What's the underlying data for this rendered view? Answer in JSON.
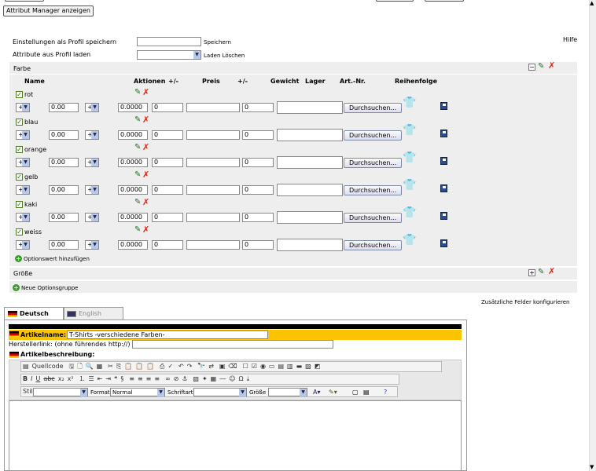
{
  "top": {
    "attr_manager_button": "Attribut Manager anzeigen",
    "help": "Hilfe"
  },
  "profile": {
    "save_label": "Einstellungen als Profil speichern",
    "save_link": "Speichern",
    "load_label": "Attribute aus Profil laden",
    "load_link": "Laden Löschen"
  },
  "group_farbe": {
    "title": "Farbe",
    "columns": {
      "name": "Name",
      "aktionen": "Aktionen",
      "pm1": "+/-",
      "preis": "Preis",
      "pm2": "+/-",
      "gewicht": "Gewicht",
      "lager": "Lager",
      "artnr": "Art.-Nr.",
      "reihenfolge": "Reihenfolge"
    },
    "rows": [
      {
        "name": "rot",
        "sign": "+",
        "price": "0.00",
        "sign2": "+",
        "weight": "0.0000",
        "stock1": "0",
        "stock2": "0",
        "color": "#d81818"
      },
      {
        "name": "blau",
        "sign": "+",
        "price": "0.00",
        "sign2": "+",
        "weight": "0.0000",
        "stock1": "0",
        "stock2": "0",
        "color": "#12307a"
      },
      {
        "name": "orange",
        "sign": "+",
        "price": "0.00",
        "sign2": "+",
        "weight": "0.0000",
        "stock1": "0",
        "stock2": "0",
        "color": "#f59a1a"
      },
      {
        "name": "gelb",
        "sign": "+",
        "price": "0.00",
        "sign2": "+",
        "weight": "0.0000",
        "stock1": "0",
        "stock2": "0",
        "color": "#f4dc10"
      },
      {
        "name": "kaki",
        "sign": "+",
        "price": "0.00",
        "sign2": "+",
        "weight": "0.0000",
        "stock1": "0",
        "stock2": "0",
        "color": "#222222"
      },
      {
        "name": "weiss",
        "sign": "+",
        "price": "0.00",
        "sign2": "+",
        "weight": "0.0000",
        "stock1": "0",
        "stock2": "0",
        "color": "#ffffff"
      }
    ],
    "browse_label": "Durchsuchen...",
    "add_option": "Optionswert hinzufügen"
  },
  "group_groesse": {
    "title": "Größe"
  },
  "new_group": "Neue Optionsgruppe",
  "extra_fields": "Zusätzliche Felder konfigurieren",
  "tabs": [
    {
      "label": "Deutsch"
    },
    {
      "label": "English"
    }
  ],
  "article": {
    "name_label": "Artikelname:",
    "name_value": "T-Shirts -verschiedene Farben-",
    "manufacturer_label": "Herstellerlink: (ohne führendes http://)",
    "desc_label": "Artikelbeschreibung:"
  },
  "editor": {
    "source": "Quellcode",
    "style_label": "Stil",
    "format_label": "Format",
    "format_value": "Normal",
    "font_label": "Schriftart",
    "size_label": "Größe"
  }
}
